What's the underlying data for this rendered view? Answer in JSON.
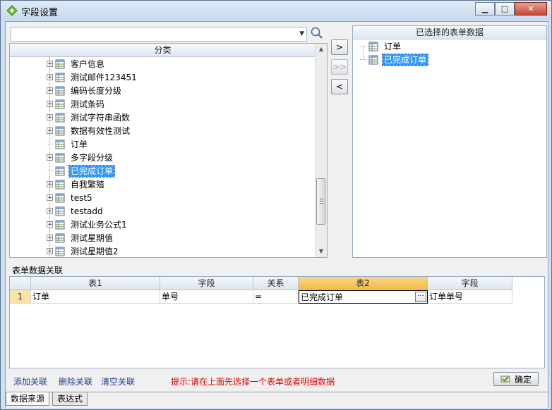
{
  "window": {
    "title": "字段设置"
  },
  "search": {
    "value": ""
  },
  "left_panel": {
    "header": "分类",
    "items": [
      {
        "label": "客户信息",
        "expandable": true
      },
      {
        "label": "测试邮件123451",
        "expandable": true
      },
      {
        "label": "编码长度分级",
        "expandable": true
      },
      {
        "label": "测试条码",
        "expandable": true
      },
      {
        "label": "测试字符串函数",
        "expandable": true
      },
      {
        "label": "数据有效性测试",
        "expandable": true
      },
      {
        "label": "订单",
        "expandable": false
      },
      {
        "label": "多字段分级",
        "expandable": true
      },
      {
        "label": "已完成订单",
        "expandable": false,
        "selected": true
      },
      {
        "label": "自我繁殖",
        "expandable": true
      },
      {
        "label": "test5",
        "expandable": true
      },
      {
        "label": "testadd",
        "expandable": true
      },
      {
        "label": "测试业务公式1",
        "expandable": true
      },
      {
        "label": "测试星期值",
        "expandable": true
      },
      {
        "label": "测试星期值2",
        "expandable": true
      }
    ]
  },
  "move_buttons": {
    "add": ">",
    "add_all": ">>",
    "remove": "<"
  },
  "right_panel": {
    "header": "已选择的表单数据",
    "items": [
      {
        "label": "订单",
        "selected": false
      },
      {
        "label": "已完成订单",
        "selected": true
      }
    ]
  },
  "relations": {
    "title": "表单数据关联",
    "columns": [
      "表1",
      "字段",
      "关系",
      "表2",
      "字段"
    ],
    "rows": [
      {
        "num": "1",
        "table1": "订单",
        "field1": "单号",
        "relation": "=",
        "table2": "已完成订单",
        "field2": "订单单号"
      }
    ]
  },
  "actions": {
    "add": "添加关联",
    "delete": "删除关联",
    "clear": "清空关联"
  },
  "hint": "提示:请在上面先选择一个表单或者明细数据",
  "ok_label": "确定",
  "tabs": [
    "数据来源",
    "表达式"
  ],
  "colors": {
    "selection": "#3399ff",
    "hint": "#e00000",
    "active_header": "#f3b944"
  }
}
